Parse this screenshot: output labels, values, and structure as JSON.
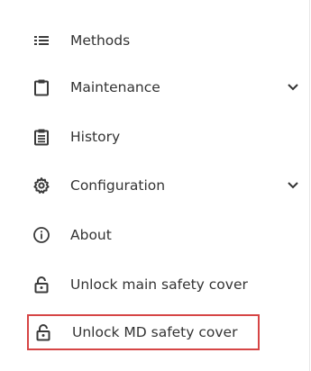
{
  "menu": {
    "items": [
      {
        "label": "Methods",
        "icon": "list-icon"
      },
      {
        "label": "Maintenance",
        "icon": "clipboard-icon",
        "expandable": true
      },
      {
        "label": "History",
        "icon": "document-list-icon"
      },
      {
        "label": "Configuration",
        "icon": "gear-icon",
        "expandable": true
      },
      {
        "label": "About",
        "icon": "info-icon"
      },
      {
        "label": "Unlock main safety cover",
        "icon": "unlock-icon"
      },
      {
        "label": "Unlock MD safety cover",
        "icon": "unlock-icon",
        "highlighted": true
      }
    ]
  },
  "colors": {
    "text": "#333333",
    "icon": "#3a3a3a",
    "highlight": "#d64545"
  }
}
